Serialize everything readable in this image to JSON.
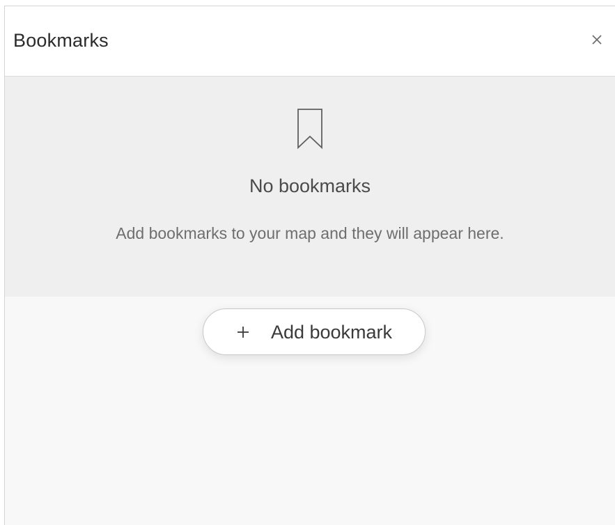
{
  "header": {
    "title": "Bookmarks",
    "close_icon": "close-icon"
  },
  "empty_state": {
    "icon": "bookmark-icon",
    "title": "No bookmarks",
    "description": "Add bookmarks to your map and they will appear here."
  },
  "actions": {
    "add_icon": "plus-icon",
    "add_label": "Add bookmark"
  },
  "colors": {
    "panel_background": "#f8f8f8",
    "empty_background": "#efefef",
    "header_background": "#ffffff",
    "border": "#d4d4d4"
  }
}
